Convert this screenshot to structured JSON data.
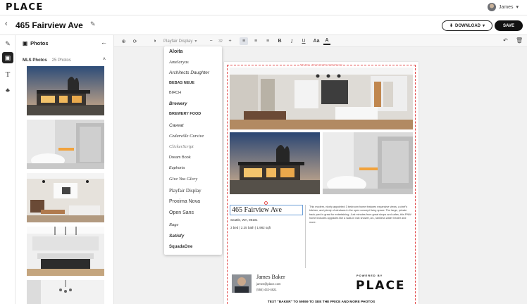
{
  "app": {
    "logo": "PLACE",
    "user_name": "James",
    "user_caret": "▾"
  },
  "header": {
    "back": "‹",
    "title": "465 Fairview Ave",
    "download_label": "DOWNLOAD",
    "save_label": "SAVE"
  },
  "sidebar": {
    "panel_title": "Photos",
    "section_label": "MLS Photos",
    "section_count": "25 Photos"
  },
  "toolbar": {
    "font_select": "Playfair Display",
    "font_size": "32",
    "minus": "−",
    "plus": "+",
    "bold": "B",
    "italic": "I",
    "underline": "U",
    "case": "Aa",
    "color_letter": "A"
  },
  "font_menu": {
    "items": [
      "Aloita",
      "Amelaryas",
      "Architects Daughter",
      "BEBAS NEUE",
      "BIRCH",
      "Brewery",
      "BREWERY FOOD",
      "Caveat",
      "Cedarville Cursive",
      "ClickerScript",
      "Dream Book",
      "Euphoria",
      "Give You Glory",
      "Playfair Display",
      "Proxima Nova",
      "Open Sans",
      "Rage",
      "Satisfy",
      "SquadaOne"
    ]
  },
  "flyer": {
    "safe_zone_note": "Safe Zone - All text should be inside this area",
    "address": "465 Fairview Ave",
    "city": "Seattle, WA, 98101",
    "stats": "3 bed | 2.25 bath | 1,982 sqft",
    "description": "This modern, nicely appointed 3 bedroom home features expansive views, a chef's kitchen, and plenty of windows in the open concept living space. The large, private back yard is great for entertaining. Just minutes from great shops and cafes, this PNW home includes upgrades like a walk-in rain shower, AC, tankless water heater and more.",
    "agent_name": "James Baker",
    "agent_email": "james@place.com",
    "agent_phone": "(555) 432-4821",
    "powered_by": "POWERED BY",
    "powered_logo": "PLACE",
    "cta": "TEXT \"BAKER\" TO 59559 TO SEE THE PRICE AND MORE PHOTOS"
  },
  "icons": {
    "rail": [
      "edit-icon",
      "photos-icon",
      "text-icon",
      "elements-icon"
    ],
    "toolbar": [
      "zoom-icon",
      "refresh-icon",
      "contrast-icon",
      "align-left-icon",
      "align-center-icon",
      "align-right-icon"
    ]
  }
}
